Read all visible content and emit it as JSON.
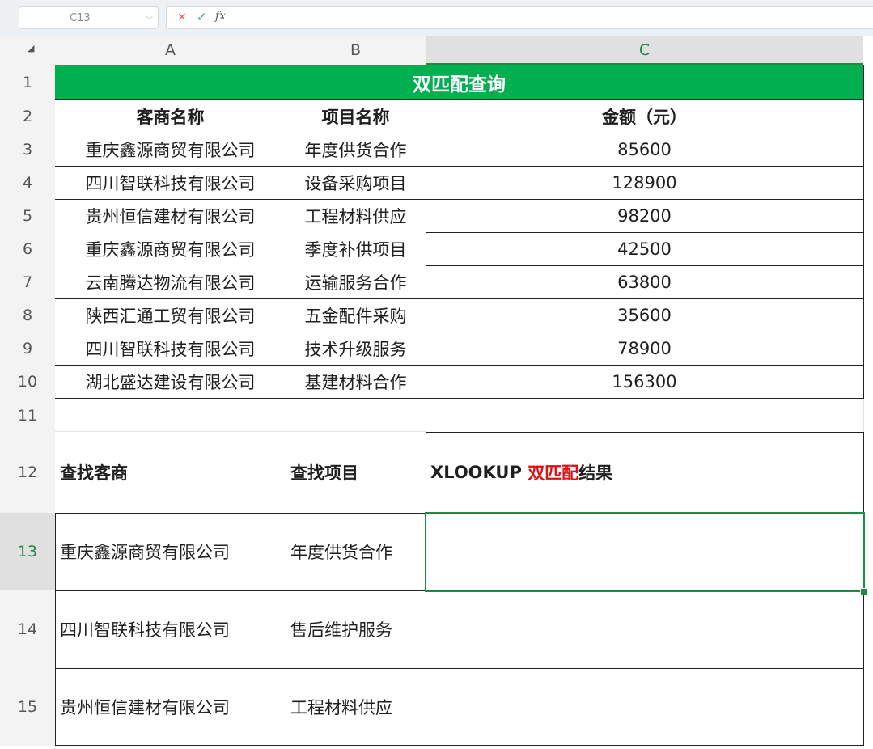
{
  "formula_bar": {
    "cell_ref": "C13",
    "cancel_glyph": "×",
    "confirm_glyph": "✓",
    "fx_label": "fx",
    "formula_value": ""
  },
  "columns": [
    "A",
    "B",
    "C"
  ],
  "rows": [
    "1",
    "2",
    "3",
    "4",
    "5",
    "6",
    "7",
    "8",
    "9",
    "10",
    "11",
    "12",
    "13",
    "14",
    "15"
  ],
  "table": {
    "title": "双匹配查询",
    "headers": [
      "客商名称",
      "项目名称",
      "金额（元）"
    ],
    "records": [
      [
        "重庆鑫源商贸有限公司",
        "年度供货合作",
        "85600"
      ],
      [
        "四川智联科技有限公司",
        "设备采购项目",
        "128900"
      ],
      [
        "贵州恒信建材有限公司",
        "工程材料供应",
        "98200"
      ],
      [
        "重庆鑫源商贸有限公司",
        "季度补供项目",
        "42500"
      ],
      [
        "云南腾达物流有限公司",
        "运输服务合作",
        "63800"
      ],
      [
        "陕西汇通工贸有限公司",
        "五金配件采购",
        "35600"
      ],
      [
        "四川智联科技有限公司",
        "技术升级服务",
        "78900"
      ],
      [
        "湖北盛达建设有限公司",
        "基建材料合作",
        "156300"
      ]
    ]
  },
  "lookup": {
    "header_customer": "查找客商",
    "header_project": "查找项目",
    "header_result_prefix": "XLOOKUP ",
    "header_result_highlight": "双匹配",
    "header_result_suffix": "结果",
    "queries": [
      [
        "重庆鑫源商贸有限公司",
        "年度供货合作",
        ""
      ],
      [
        "四川智联科技有限公司",
        "售后维护服务",
        ""
      ],
      [
        "贵州恒信建材有限公司",
        "工程材料供应",
        ""
      ]
    ]
  },
  "colors": {
    "title_fill": "#00b050",
    "selection": "#1e8a45",
    "highlight_text": "#e10f0f"
  }
}
